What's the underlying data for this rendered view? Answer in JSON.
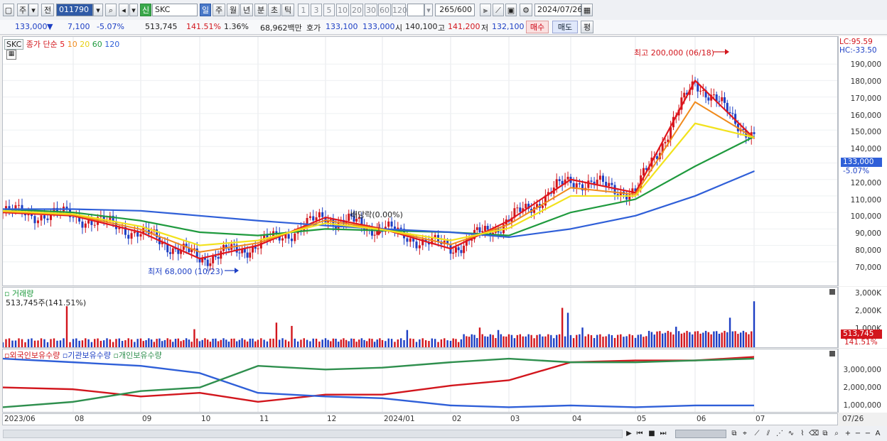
{
  "toolbar": {
    "type_label": "주",
    "jeon_label": "전",
    "code_value": "011790",
    "shin_label": "신",
    "name_value": "SKC",
    "periods": [
      "일",
      "주",
      "월",
      "년",
      "분",
      "초",
      "틱"
    ],
    "intervals": [
      "1",
      "3",
      "5",
      "10",
      "20",
      "30",
      "60",
      "120"
    ],
    "count_value": "265",
    "count_total": "/600",
    "date_value": "2024/07/26"
  },
  "quote": {
    "price": "133,000",
    "down_arrow": "▼",
    "change": "7,100",
    "change_pct": "-5.07%",
    "volume": "513,745",
    "volume_pct": "141.51%",
    "turnover_pct": "1.36%",
    "amount": "68,962백만",
    "hoga_label": "호가",
    "ask": "133,100",
    "bid": "133,000",
    "open_label": "시",
    "open": "140,100",
    "high_label": "고",
    "high": "141,200",
    "low_label": "저",
    "low": "132,100",
    "buy_label": "매수",
    "sell_label": "매도",
    "eval_label": "평"
  },
  "price_panel": {
    "name_tag": "SKC",
    "ma_title": "종가 단순",
    "ma_periods": [
      "5",
      "10",
      "20",
      "60",
      "120"
    ],
    "lc": "LC:95.59",
    "hc": "HC:-33.50",
    "high_note": "최고 200,000 (06/18)",
    "low_note": "최저 68,000 (10/23)",
    "dividend_note": "배당락(0.00%)",
    "current_price": "133,000",
    "current_pct": "-5.07%",
    "y_ticks": [
      "190,000",
      "180,000",
      "170,000",
      "160,000",
      "150,000",
      "140,000",
      "130,000",
      "120,000",
      "110,000",
      "100,000",
      "90,000",
      "80,000",
      "70,000"
    ]
  },
  "volume_panel": {
    "title": "거래량",
    "current": "513,745주(141.51%)",
    "y_ticks": [
      "3,000K",
      "2,000K",
      "1,000K"
    ],
    "box_value": "513,745",
    "box_pct": "141.51%"
  },
  "holding_panel": {
    "legends": [
      "외국인보유수량",
      "기관보유수량",
      "개인보유수량"
    ],
    "y_ticks": [
      "3,000,000",
      "2,000,000",
      "1,000,000"
    ]
  },
  "x_axis": [
    "2023/06",
    "08",
    "09",
    "10",
    "11",
    "12",
    "2024/01",
    "02",
    "03",
    "04",
    "05",
    "06",
    "07"
  ],
  "x_axis_end": "07/26",
  "colors": {
    "up": "#d2161d",
    "down": "#1d3fc4",
    "ma5": "#e0161d",
    "ma10": "#f08a1c",
    "ma20": "#f2e21c",
    "ma60": "#1f9a3e",
    "ma120": "#2f5fd8",
    "foreign": "#d2161d",
    "institution": "#2f5fd8",
    "individual": "#2f8f4e"
  },
  "chart_data": {
    "type": "line",
    "title": "SKC",
    "x": [
      "2023/06",
      "08",
      "09",
      "10",
      "11",
      "12",
      "2024/01",
      "02",
      "03",
      "04",
      "05",
      "06",
      "07"
    ],
    "series": [
      {
        "name": "종가 단순 5",
        "values": [
          100000,
          98000,
          88000,
          72000,
          80000,
          97000,
          90000,
          78000,
          95000,
          120000,
          112000,
          180000,
          145000
        ]
      },
      {
        "name": "종가 단순 60",
        "values": [
          102000,
          100000,
          95000,
          88000,
          86000,
          90000,
          89000,
          88000,
          86000,
          100000,
          108000,
          128000,
          146000
        ]
      },
      {
        "name": "종가 단순 120",
        "values": [
          102000,
          102000,
          101000,
          98000,
          95000,
          92000,
          90000,
          88000,
          85000,
          90000,
          98000,
          110000,
          125000
        ]
      }
    ],
    "ylim": [
      60000,
      200000
    ]
  }
}
